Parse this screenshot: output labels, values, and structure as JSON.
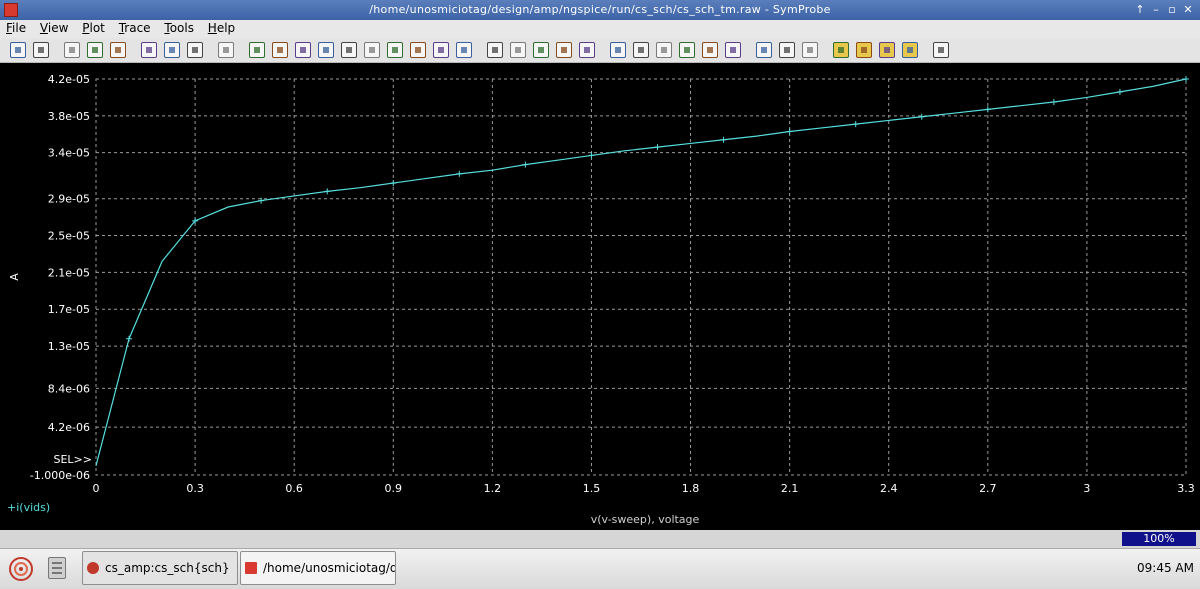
{
  "window": {
    "title": "/home/unosmiciotag/design/amp/ngspice/run/cs_sch/cs_sch_tm.raw - SymProbe",
    "controls": [
      "↑",
      "–",
      "▫",
      "✕"
    ]
  },
  "menu": [
    "File",
    "View",
    "Plot",
    "Trace",
    "Tools",
    "Help"
  ],
  "toolbar_icons": [
    "open-icon",
    "save-icon",
    "print-icon",
    "first-page-icon",
    "previous-page-icon",
    "zoom-in-icon",
    "zoom-out-icon",
    "zoom-fit-icon",
    "crosshair-icon",
    "new-graph-icon",
    "delete-graph-icon",
    "graph-icon",
    "graph-stack-icon",
    "move-up-icon",
    "move-down-icon",
    "align-icon",
    "copy-graph-icon",
    "paste-graph-icon",
    "pan-icon",
    "trace-icon",
    "bar-icon",
    "copy-icon",
    "paste-icon",
    "house-icon",
    "sum-icon",
    "xy-icon",
    "fft-icon",
    "bode-icon",
    "spectrum-icon",
    "eye-icon",
    "table-icon",
    "columns-icon",
    "rows-icon",
    "cursor-a-icon",
    "cursor-b-icon",
    "marker-icon",
    "measure-icon",
    "probe-icon"
  ],
  "colors": {
    "trace": "#55dede",
    "grid": "#9a9a9a",
    "plot_bg": "#000000",
    "axis_text": "#ffffff"
  },
  "chart_data": {
    "type": "line",
    "xlabel": "v(v-sweep), voltage",
    "ylabel": "A",
    "x_ticks": [
      "0",
      "0.3",
      "0.6",
      "0.9",
      "1.2",
      "1.5",
      "1.8",
      "2.1",
      "2.4",
      "2.7",
      "3",
      "3.3"
    ],
    "y_ticks": [
      "4.2e-05",
      "3.8e-05",
      "3.4e-05",
      "2.9e-05",
      "2.5e-05",
      "2.1e-05",
      "1.7e-05",
      "1.3e-05",
      "8.4e-06",
      "4.2e-06",
      "-1.000e-06"
    ],
    "xlim": [
      0,
      3.3
    ],
    "ylim": [
      -1e-06,
      4.2e-05
    ],
    "grid": true,
    "selected_marker": "SEL>>",
    "series": [
      {
        "name": "i(vids)",
        "x": [
          0,
          0.1,
          0.2,
          0.3,
          0.4,
          0.5,
          0.6,
          0.7,
          0.8,
          0.9,
          1.0,
          1.1,
          1.2,
          1.3,
          1.4,
          1.5,
          1.6,
          1.7,
          1.8,
          1.9,
          2.0,
          2.1,
          2.2,
          2.3,
          2.4,
          2.5,
          2.6,
          2.7,
          2.8,
          2.9,
          3.0,
          3.1,
          3.2,
          3.3
        ],
        "y": [
          0,
          1.38e-05,
          2.22e-05,
          2.66e-05,
          2.81e-05,
          2.88e-05,
          2.93e-05,
          2.98e-05,
          3.02e-05,
          3.07e-05,
          3.12e-05,
          3.17e-05,
          3.21e-05,
          3.27e-05,
          3.32e-05,
          3.37e-05,
          3.42e-05,
          3.46e-05,
          3.5e-05,
          3.54e-05,
          3.58e-05,
          3.63e-05,
          3.67e-05,
          3.71e-05,
          3.75e-05,
          3.79e-05,
          3.83e-05,
          3.87e-05,
          3.91e-05,
          3.95e-05,
          4e-05,
          4.06e-05,
          4.12e-05,
          4.2e-05
        ],
        "markers_x": [
          0.1,
          0.3,
          0.5,
          0.7,
          0.9,
          1.1,
          1.3,
          1.5,
          1.7,
          1.9,
          2.1,
          2.3,
          2.5,
          2.7,
          2.9,
          3.1,
          3.3
        ]
      }
    ]
  },
  "status": {
    "progress": "100%"
  },
  "taskbar": {
    "tasks": [
      {
        "label": "cs_amp:cs_sch{sch}"
      },
      {
        "label": "/home/unosmiciotag/de..."
      }
    ],
    "clock": "09:45 AM"
  }
}
